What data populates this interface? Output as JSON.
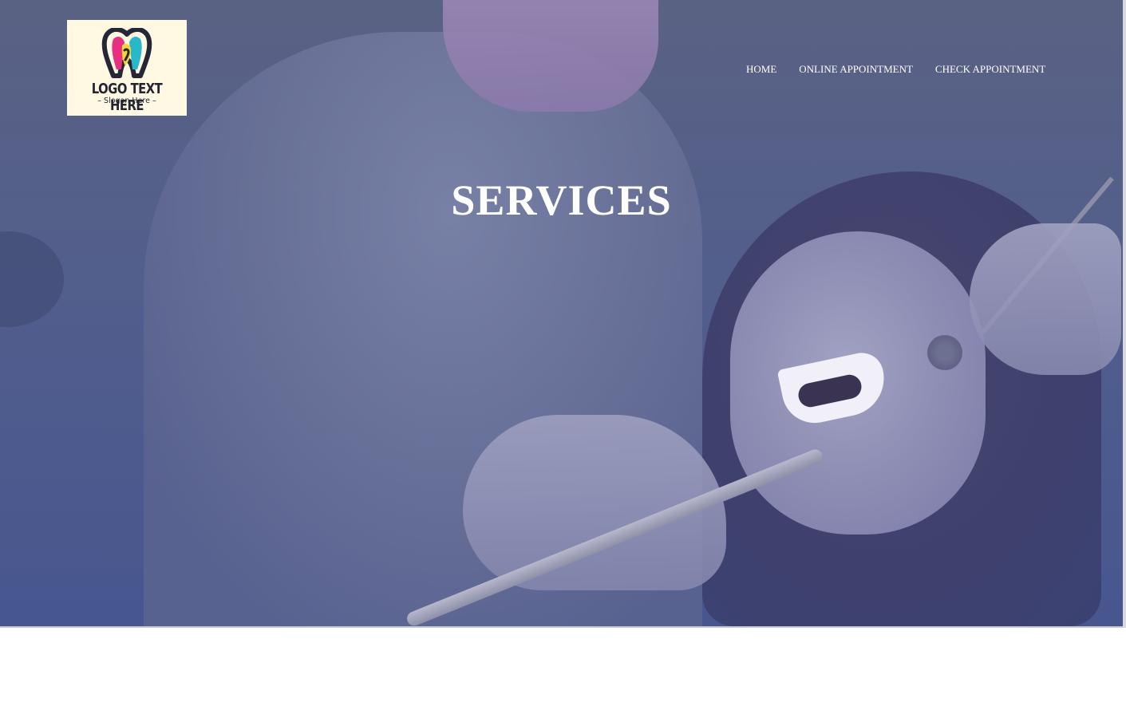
{
  "logo": {
    "text": "LOGO TEXT HERE",
    "slogan": "– Slogan Here –",
    "colors": {
      "pink": "#e7307f",
      "teal": "#29b8c9",
      "yellow": "#f4d63a",
      "outline": "#252737",
      "background": "#fff8e2"
    }
  },
  "nav": {
    "items": [
      {
        "label": "HOME"
      },
      {
        "label": "ONLINE APPOINTMENT"
      },
      {
        "label": "CHECK APPOINTMENT"
      }
    ]
  },
  "hero": {
    "title": "SERVICES",
    "overlay_color": "#4f5b8c"
  }
}
